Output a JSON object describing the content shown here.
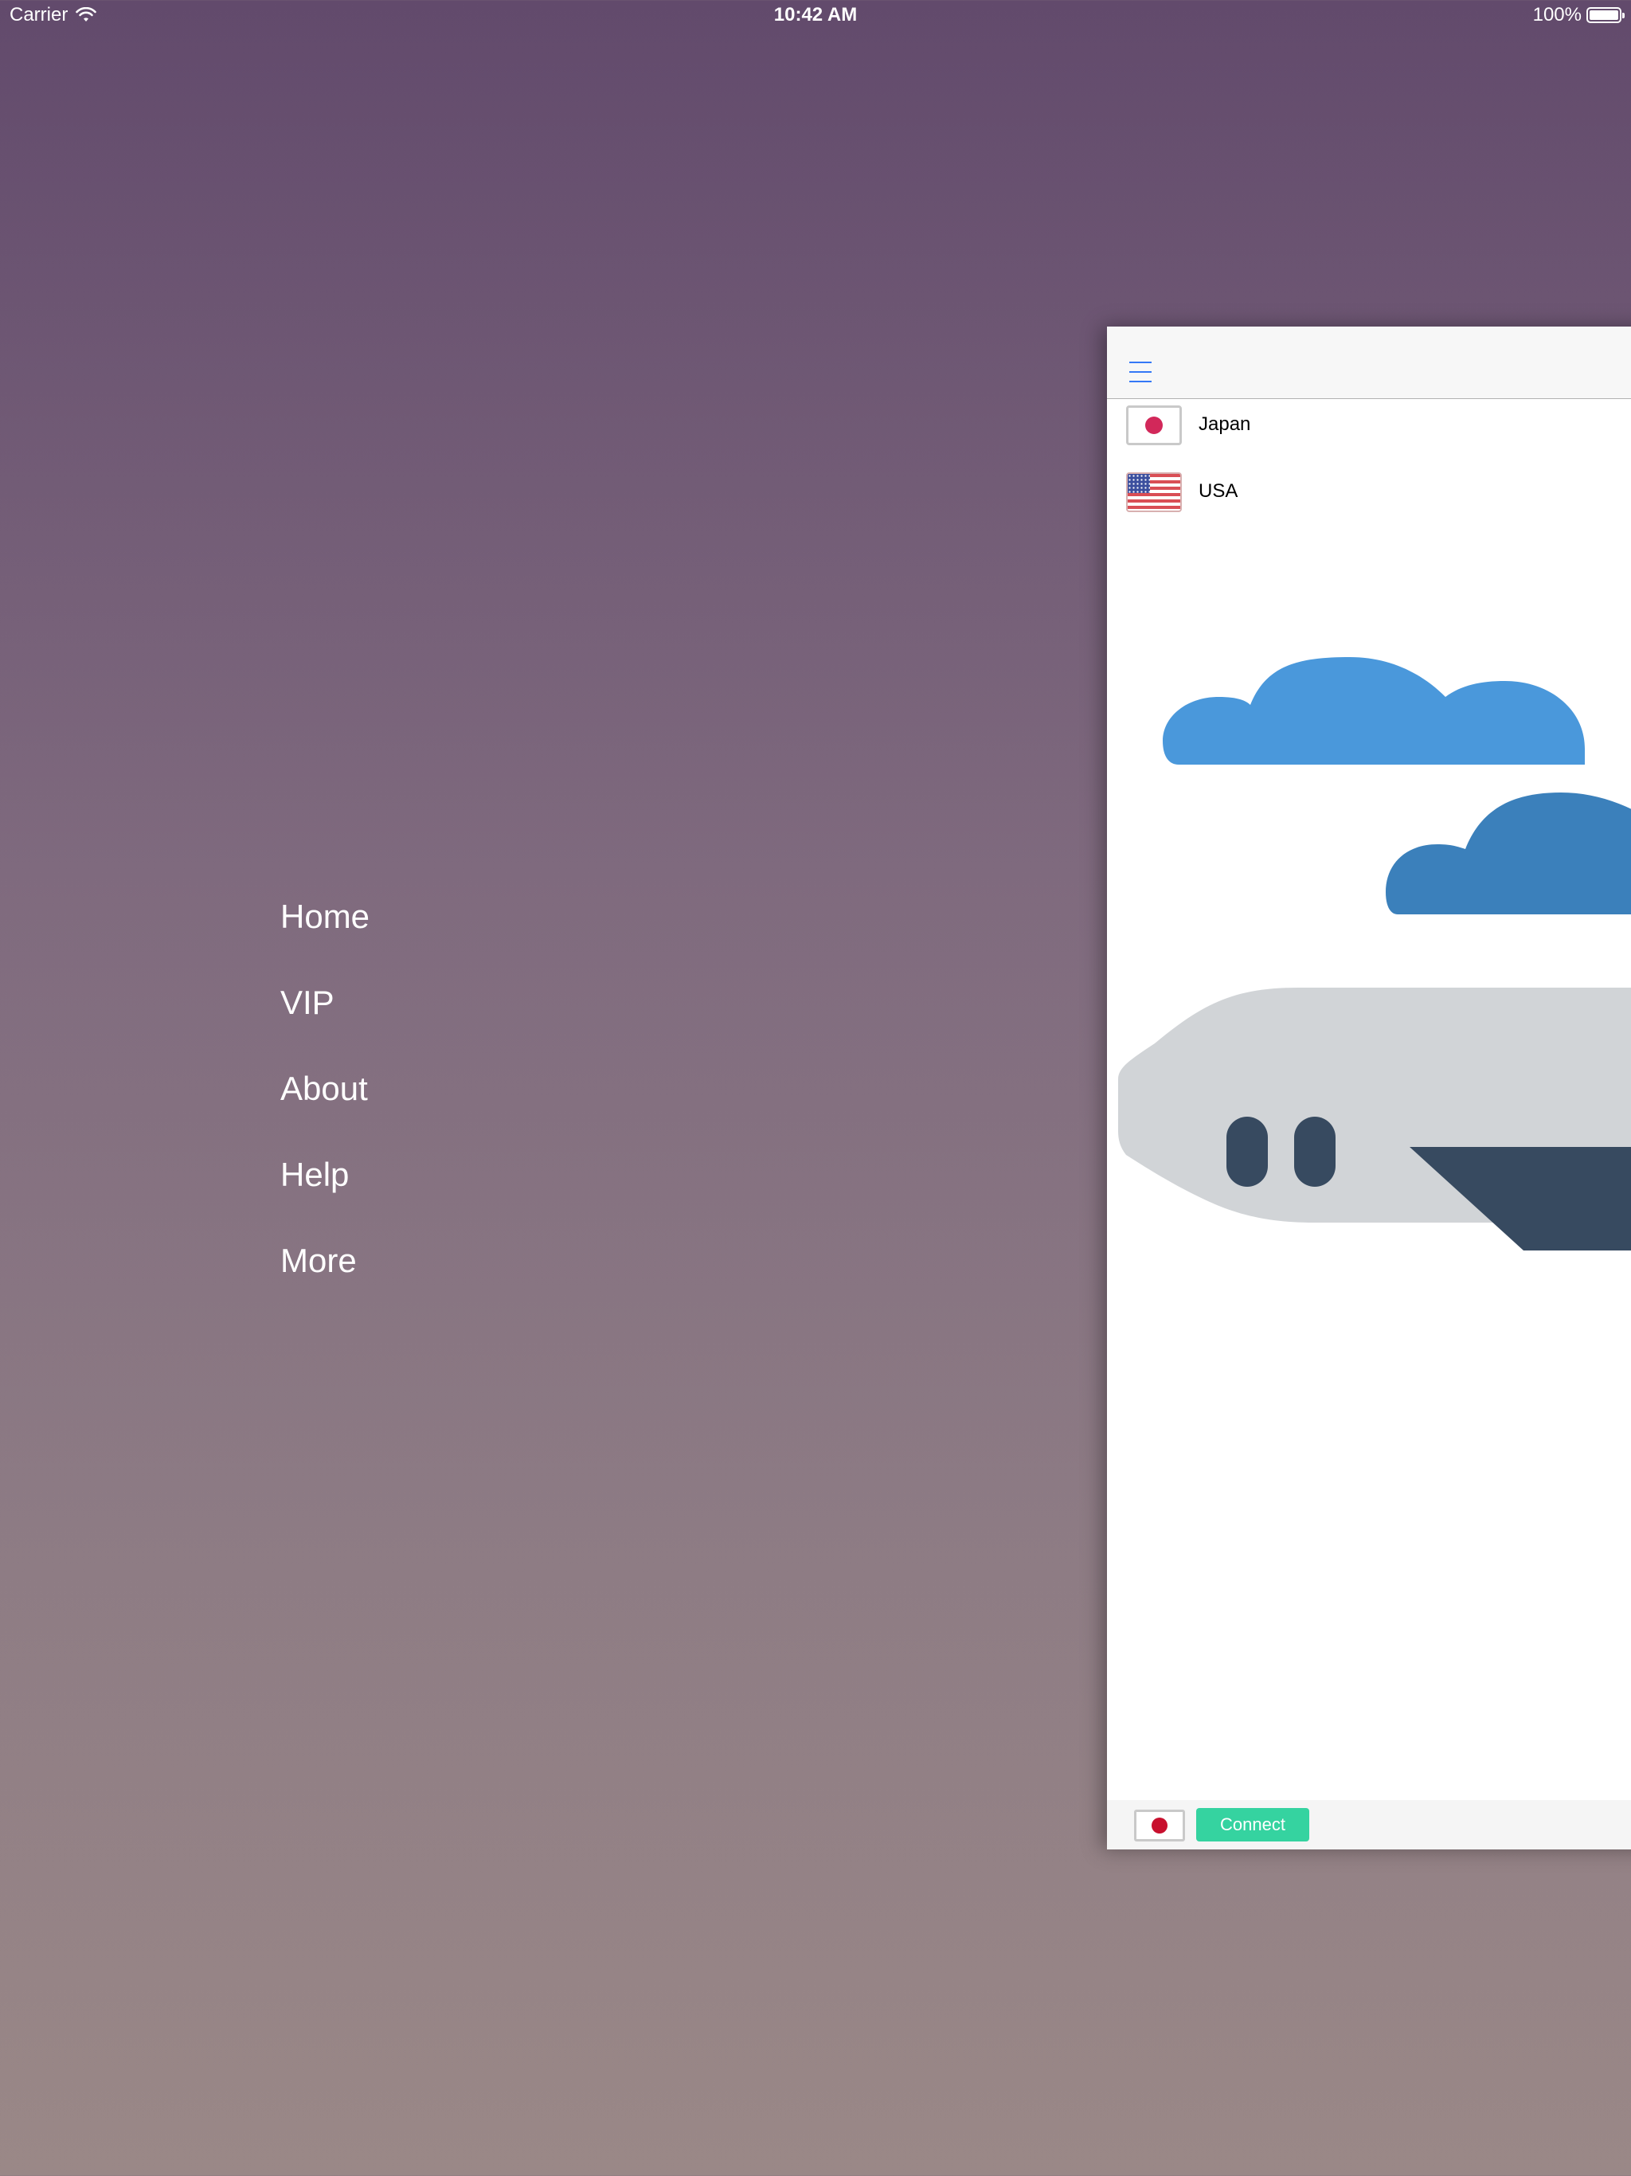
{
  "status_bar": {
    "carrier": "Carrier",
    "time": "10:42 AM",
    "battery": "100%",
    "icons": [
      "wifi-icon",
      "battery-icon"
    ]
  },
  "side_menu": {
    "items": [
      {
        "label": "Home"
      },
      {
        "label": "VIP"
      },
      {
        "label": "About"
      },
      {
        "label": "Help"
      },
      {
        "label": "More"
      }
    ]
  },
  "main": {
    "nav": {
      "menu_icon": "hamburger-icon"
    },
    "servers": [
      {
        "name": "Japan",
        "flag": "japan-flag-icon"
      },
      {
        "name": "USA",
        "flag": "usa-flag-icon"
      }
    ],
    "bottom_bar": {
      "selected_flag": "japan-flag-icon",
      "connect_label": "Connect"
    }
  },
  "colors": {
    "background_top": "#624a6c",
    "background_bottom": "#9a8887",
    "accent": "#3478f6",
    "connect": "#35d3a0",
    "cloud_light": "#4a98db",
    "cloud_dark": "#3b80bb",
    "plane_body": "#d1d4d7",
    "plane_dark": "#374a60"
  }
}
